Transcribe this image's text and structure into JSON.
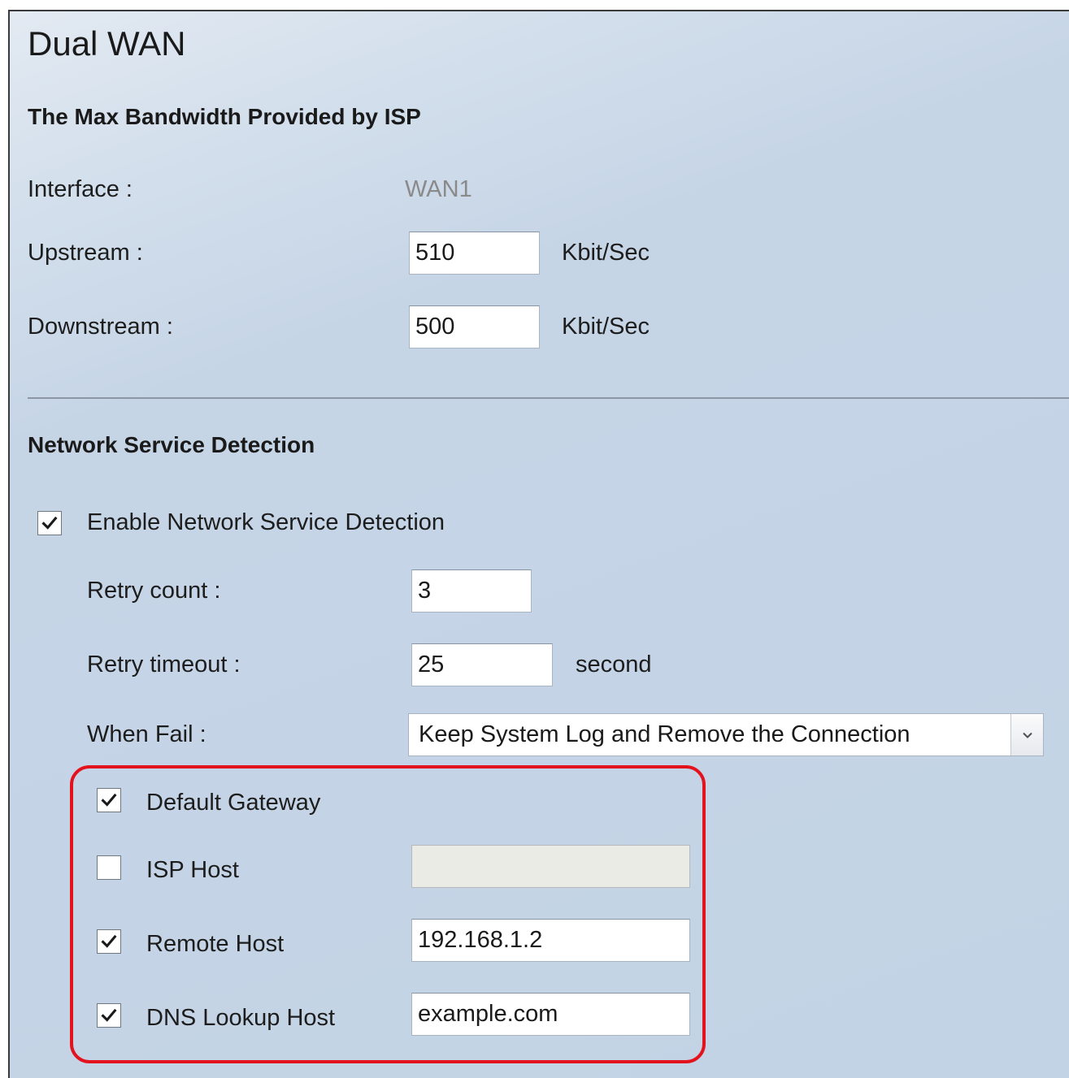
{
  "page": {
    "title": "Dual WAN"
  },
  "bandwidth": {
    "section_title": "The Max Bandwidth Provided by ISP",
    "interface_label": "Interface :",
    "interface_value": "WAN1",
    "upstream_label": "Upstream :",
    "upstream_value": "510",
    "upstream_unit": "Kbit/Sec",
    "downstream_label": "Downstream :",
    "downstream_value": "500",
    "downstream_unit": "Kbit/Sec"
  },
  "detection": {
    "section_title": "Network Service Detection",
    "enable_label": "Enable Network Service Detection",
    "enable_checked": true,
    "retry_count_label": "Retry count :",
    "retry_count_value": "3",
    "retry_timeout_label": "Retry timeout :",
    "retry_timeout_value": "25",
    "retry_timeout_unit": "second",
    "when_fail_label": "When Fail :",
    "when_fail_value": "Keep System Log and Remove the Connection",
    "hosts": {
      "default_gateway": {
        "label": "Default Gateway",
        "checked": true
      },
      "isp_host": {
        "label": "ISP Host",
        "checked": false,
        "value": ""
      },
      "remote_host": {
        "label": "Remote Host",
        "checked": true,
        "value": "192.168.1.2"
      },
      "dns_lookup_host": {
        "label": "DNS Lookup Host",
        "checked": true,
        "value": "example.com"
      }
    }
  },
  "colors": {
    "background": "#c2d3e5",
    "highlight": "#e3131e",
    "muted_text": "#8a8a8a"
  },
  "icons": {
    "checkmark": "checkmark-icon",
    "dropdown": "chevron-down-icon"
  }
}
